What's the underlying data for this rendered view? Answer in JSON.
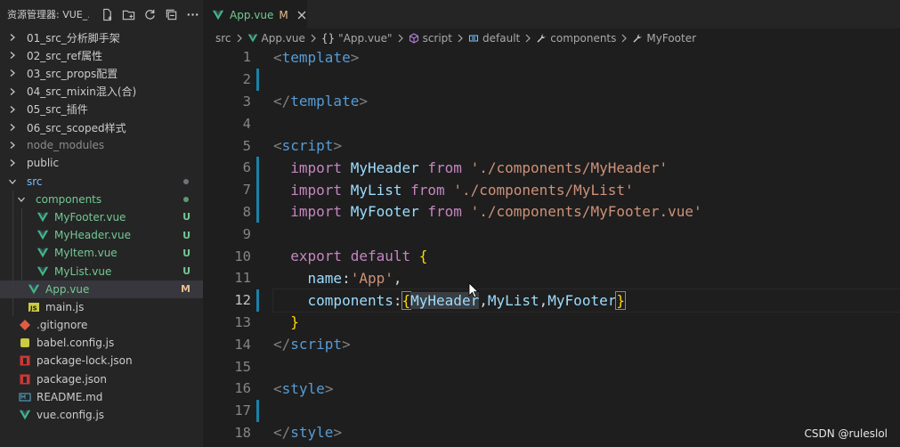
{
  "sidebar": {
    "title": "资源管理器: VUE_...",
    "actions": [
      "new-file-icon",
      "new-folder-icon",
      "refresh-icon",
      "collapse-all-icon",
      "more-icon"
    ],
    "items": [
      {
        "label": "01_src_分析脚手架",
        "type": "folder",
        "depth": 0,
        "open": false
      },
      {
        "label": "02_src_ref属性",
        "type": "folder",
        "depth": 0,
        "open": false
      },
      {
        "label": "03_src_props配置",
        "type": "folder",
        "depth": 0,
        "open": false
      },
      {
        "label": "04_src_mixin混入(合)",
        "type": "folder",
        "depth": 0,
        "open": false
      },
      {
        "label": "05_src_插件",
        "type": "folder",
        "depth": 0,
        "open": false
      },
      {
        "label": "06_src_scoped样式",
        "type": "folder",
        "depth": 0,
        "open": false
      },
      {
        "label": "node_modules",
        "type": "node",
        "depth": 0,
        "open": false
      },
      {
        "label": "public",
        "type": "folder",
        "depth": 0,
        "open": false
      },
      {
        "label": "src",
        "type": "folder",
        "depth": 0,
        "open": true,
        "status": "dot"
      },
      {
        "label": "components",
        "type": "folder",
        "depth": 1,
        "open": true,
        "status": "dot-green"
      },
      {
        "label": "MyFooter.vue",
        "type": "vue",
        "depth": 2,
        "status": "U"
      },
      {
        "label": "MyHeader.vue",
        "type": "vue",
        "depth": 2,
        "status": "U"
      },
      {
        "label": "MyItem.vue",
        "type": "vue",
        "depth": 2,
        "status": "U"
      },
      {
        "label": "MyList.vue",
        "type": "vue",
        "depth": 2,
        "status": "U"
      },
      {
        "label": "App.vue",
        "type": "vue",
        "depth": 1,
        "status": "M",
        "selected": true
      },
      {
        "label": "main.js",
        "type": "js",
        "depth": 1
      },
      {
        "label": ".gitignore",
        "type": "git",
        "depth": 0
      },
      {
        "label": "babel.config.js",
        "type": "babel",
        "depth": 0
      },
      {
        "label": "package-lock.json",
        "type": "npm",
        "depth": 0
      },
      {
        "label": "package.json",
        "type": "npm",
        "depth": 0
      },
      {
        "label": "README.md",
        "type": "md",
        "depth": 0
      },
      {
        "label": "vue.config.js",
        "type": "vue",
        "depth": 0
      }
    ]
  },
  "tab": {
    "label": "App.vue",
    "flag": "M"
  },
  "breadcrumb": [
    "src",
    "App.vue",
    "\"App.vue\"",
    "script",
    "default",
    "components",
    "MyFooter"
  ],
  "code": {
    "current_line": 12,
    "modified_lines": [
      2,
      6,
      7,
      8,
      12,
      17
    ],
    "lines": [
      [
        [
          "t-br",
          "<"
        ],
        [
          "t-tag",
          "template"
        ],
        [
          "t-br",
          ">"
        ]
      ],
      [],
      [
        [
          "t-br",
          "</"
        ],
        [
          "t-tag",
          "template"
        ],
        [
          "t-br",
          ">"
        ]
      ],
      [],
      [
        [
          "t-br",
          "<"
        ],
        [
          "t-tag",
          "script"
        ],
        [
          "t-br",
          ">"
        ]
      ],
      [
        [
          "t-pl",
          "  "
        ],
        [
          "t-kw",
          "import"
        ],
        [
          "t-pl",
          " "
        ],
        [
          "t-id",
          "MyHeader"
        ],
        [
          "t-pl",
          " "
        ],
        [
          "t-kw",
          "from"
        ],
        [
          "t-pl",
          " "
        ],
        [
          "t-str",
          "'./components/MyHeader'"
        ]
      ],
      [
        [
          "t-pl",
          "  "
        ],
        [
          "t-kw",
          "import"
        ],
        [
          "t-pl",
          " "
        ],
        [
          "t-id",
          "MyList"
        ],
        [
          "t-pl",
          " "
        ],
        [
          "t-kw",
          "from"
        ],
        [
          "t-pl",
          " "
        ],
        [
          "t-str",
          "'./components/MyList'"
        ]
      ],
      [
        [
          "t-pl",
          "  "
        ],
        [
          "t-kw",
          "import"
        ],
        [
          "t-pl",
          " "
        ],
        [
          "t-id",
          "MyFooter"
        ],
        [
          "t-pl",
          " "
        ],
        [
          "t-kw",
          "from"
        ],
        [
          "t-pl",
          " "
        ],
        [
          "t-str",
          "'./components/MyFooter.vue'"
        ]
      ],
      [],
      [
        [
          "t-pl",
          "  "
        ],
        [
          "t-kw",
          "export"
        ],
        [
          "t-pl",
          " "
        ],
        [
          "t-kw",
          "default"
        ],
        [
          "t-pl",
          " "
        ],
        [
          "t-brace",
          "{"
        ]
      ],
      [
        [
          "t-pl",
          "    "
        ],
        [
          "t-id",
          "name"
        ],
        [
          "t-pl",
          ":"
        ],
        [
          "t-str",
          "'App'"
        ],
        [
          "t-pl",
          ","
        ]
      ],
      [
        [
          "t-pl",
          "    "
        ],
        [
          "t-id",
          "components"
        ],
        [
          "t-pl",
          ":"
        ],
        [
          "t-brace bm",
          "{"
        ],
        [
          "t-id hl",
          "MyHeader"
        ],
        [
          "t-pl",
          ","
        ],
        [
          "t-id",
          "MyList"
        ],
        [
          "t-pl",
          ","
        ],
        [
          "t-id",
          "MyFooter"
        ],
        [
          "t-brace bm",
          "}"
        ]
      ],
      [
        [
          "t-pl",
          "  "
        ],
        [
          "t-brace",
          "}"
        ]
      ],
      [
        [
          "t-br",
          "</"
        ],
        [
          "t-tag",
          "script"
        ],
        [
          "t-br",
          ">"
        ]
      ],
      [],
      [
        [
          "t-br",
          "<"
        ],
        [
          "t-tag",
          "style"
        ],
        [
          "t-br",
          ">"
        ]
      ],
      [],
      [
        [
          "t-br",
          "</"
        ],
        [
          "t-tag",
          "style"
        ],
        [
          "t-br",
          ">"
        ]
      ]
    ]
  },
  "watermark": "CSDN @ruleslol",
  "colors": {
    "accent": "#1b81a8",
    "untracked": "#73c991",
    "modified": "#e2c08d"
  }
}
